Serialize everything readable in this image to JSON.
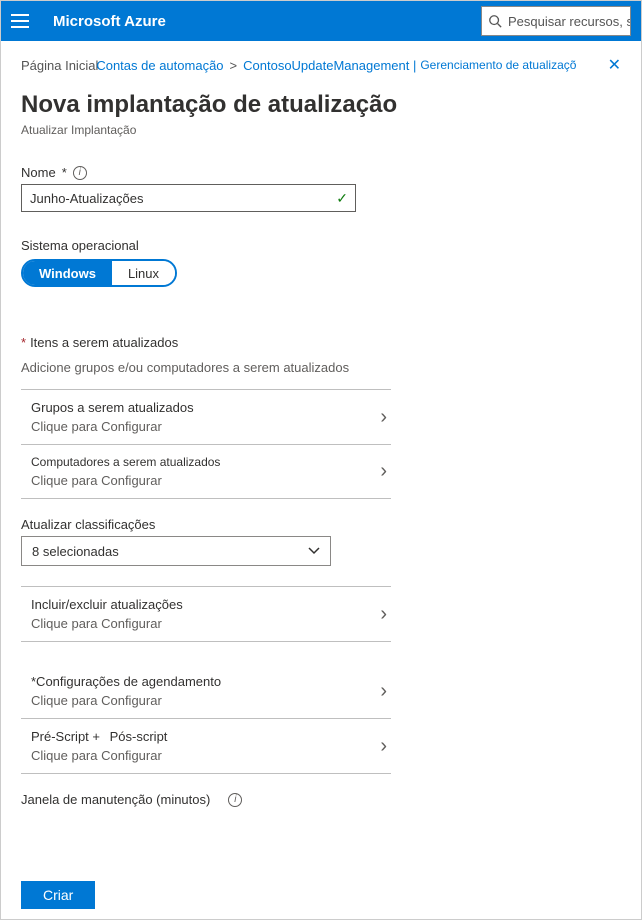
{
  "header": {
    "brand": "Microsoft Azure",
    "search_placeholder": "Pesquisar recursos, s"
  },
  "breadcrumb": {
    "items": [
      {
        "label": "Página Inicial"
      },
      {
        "label": "Contas de automação"
      },
      {
        "label": "ContosoUpdateManagement |"
      },
      {
        "label": "Gerenciamento de atualizaçõ"
      }
    ],
    "sep": ">"
  },
  "page": {
    "title": "Nova implantação de atualização",
    "subtitle": "Atualizar Implantação"
  },
  "fields": {
    "name_label": "Nome",
    "name_req": "*",
    "name_value": "Junho-Atualizações",
    "os_label": "Sistema operacional",
    "os_windows": "Windows",
    "os_linux": "Linux"
  },
  "items_section": {
    "header": "Itens a serem atualizados",
    "subtext": "Adicione grupos e/ou computadores a serem atualizados",
    "groups_title": "Grupos a serem atualizados",
    "computers_title": "Computadores a serem atualizados",
    "configure": "Clique para Configurar"
  },
  "classifications": {
    "label": "Atualizar classificações",
    "selected": "8 selecionadas"
  },
  "include_exclude": {
    "title": "Incluir/excluir atualizações",
    "configure": "Clique para Configurar"
  },
  "schedule": {
    "title": "*Configurações de agendamento",
    "configure": "Clique para Configurar"
  },
  "scripts": {
    "pre": "Pré-Script +",
    "post": "Pós-script",
    "configure": "Clique para Configurar"
  },
  "maintenance": {
    "label": "Janela de manutenção (minutos)"
  },
  "buttons": {
    "create": "Criar"
  },
  "icons": {
    "chevron": "›",
    "caret": "⌄",
    "check": "✓",
    "close": "✕",
    "info": "i"
  }
}
